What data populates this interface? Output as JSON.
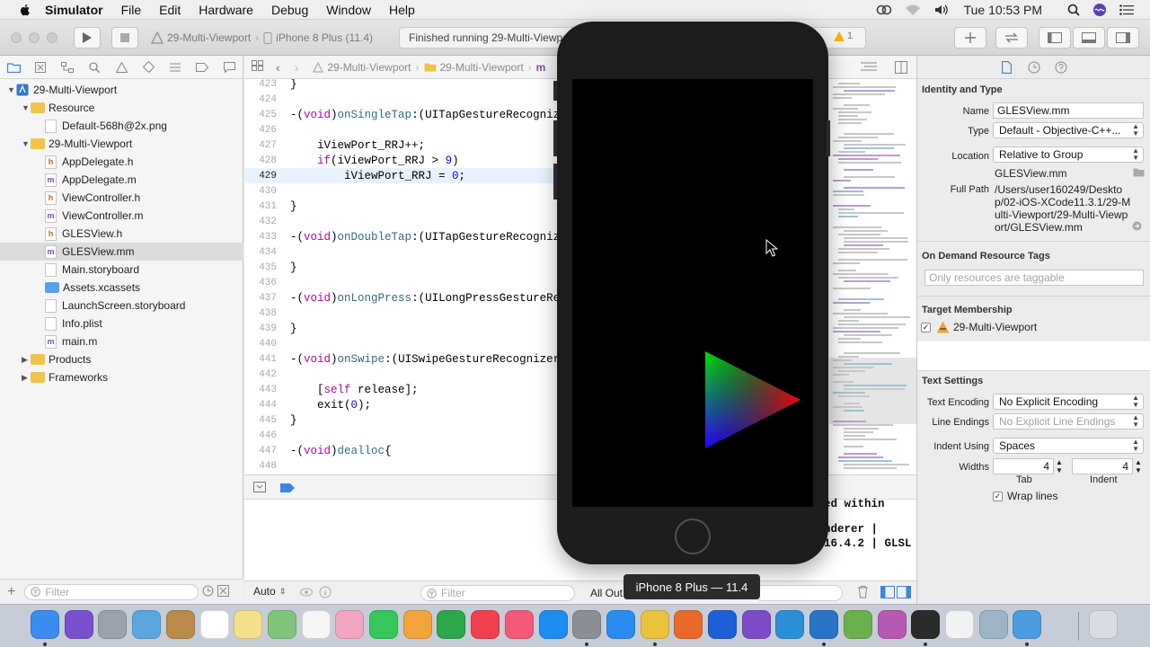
{
  "menubar": {
    "items": [
      "Simulator",
      "File",
      "Edit",
      "Hardware",
      "Debug",
      "Window",
      "Help"
    ],
    "clock": "Tue 10:53 PM"
  },
  "toolbar": {
    "scheme_project": "29-Multi-Viewport",
    "scheme_device": "iPhone 8 Plus (11.4)",
    "activity_status": "Finished running 29-Multi-Viewport",
    "warning_count": "1"
  },
  "navigator": {
    "rows": [
      {
        "label": "29-Multi-Viewport",
        "kind": "project",
        "indent": 0,
        "expanded": true
      },
      {
        "label": "Resource",
        "kind": "folder",
        "indent": 1,
        "expanded": true
      },
      {
        "label": "Default-568h@2x.png",
        "kind": "image",
        "indent": 2
      },
      {
        "label": "29-Multi-Viewport",
        "kind": "folder",
        "indent": 1,
        "expanded": true
      },
      {
        "label": "AppDelegate.h",
        "kind": "h",
        "indent": 2
      },
      {
        "label": "AppDelegate.m",
        "kind": "m",
        "indent": 2
      },
      {
        "label": "ViewController.h",
        "kind": "h",
        "indent": 2
      },
      {
        "label": "ViewController.m",
        "kind": "m",
        "indent": 2
      },
      {
        "label": "GLESView.h",
        "kind": "h",
        "indent": 2
      },
      {
        "label": "GLESView.mm",
        "kind": "m",
        "indent": 2,
        "selected": true
      },
      {
        "label": "Main.storyboard",
        "kind": "storyboard",
        "indent": 2
      },
      {
        "label": "Assets.xcassets",
        "kind": "assets",
        "indent": 2
      },
      {
        "label": "LaunchScreen.storyboard",
        "kind": "storyboard",
        "indent": 2
      },
      {
        "label": "Info.plist",
        "kind": "plist",
        "indent": 2
      },
      {
        "label": "main.m",
        "kind": "m",
        "indent": 2
      },
      {
        "label": "Products",
        "kind": "folder",
        "indent": 1,
        "expanded": false
      },
      {
        "label": "Frameworks",
        "kind": "folder",
        "indent": 1,
        "expanded": false
      }
    ],
    "filter_placeholder": "Filter"
  },
  "jumpbar": {
    "crumb1": "29-Multi-Viewport",
    "crumb2": "29-Multi-Viewport",
    "crumb3": "m"
  },
  "editor": {
    "current_line": 429,
    "lines": [
      {
        "n": "423",
        "segs": [
          {
            "t": "}",
            "c": ""
          }
        ]
      },
      {
        "n": "424",
        "segs": []
      },
      {
        "n": "425",
        "segs": [
          {
            "t": "-(",
            "c": ""
          },
          {
            "t": "void",
            "c": "kw"
          },
          {
            "t": ")",
            "c": ""
          },
          {
            "t": "onSingleTap",
            "c": "fn"
          },
          {
            "t": ":(UITapGestureRecognizer",
            "c": ""
          }
        ]
      },
      {
        "n": "426",
        "segs": []
      },
      {
        "n": "427",
        "segs": [
          {
            "t": "    iViewPort_RRJ++;",
            "c": ""
          }
        ]
      },
      {
        "n": "428",
        "segs": [
          {
            "t": "    ",
            "c": ""
          },
          {
            "t": "if",
            "c": "kw"
          },
          {
            "t": "(iViewPort_RRJ > ",
            "c": ""
          },
          {
            "t": "9",
            "c": "nm"
          },
          {
            "t": ")",
            "c": ""
          }
        ]
      },
      {
        "n": "429",
        "segs": [
          {
            "t": "        iViewPort_RRJ = ",
            "c": ""
          },
          {
            "t": "0",
            "c": "nm"
          },
          {
            "t": ";",
            "c": ""
          }
        ]
      },
      {
        "n": "430",
        "segs": []
      },
      {
        "n": "431",
        "segs": [
          {
            "t": "}",
            "c": ""
          }
        ]
      },
      {
        "n": "432",
        "segs": []
      },
      {
        "n": "433",
        "segs": [
          {
            "t": "-(",
            "c": ""
          },
          {
            "t": "void",
            "c": "kw"
          },
          {
            "t": ")",
            "c": ""
          },
          {
            "t": "onDoubleTap",
            "c": "fn"
          },
          {
            "t": ":(UITapGestureRecognizer",
            "c": ""
          }
        ]
      },
      {
        "n": "434",
        "segs": []
      },
      {
        "n": "435",
        "segs": [
          {
            "t": "}",
            "c": ""
          }
        ]
      },
      {
        "n": "436",
        "segs": []
      },
      {
        "n": "437",
        "segs": [
          {
            "t": "-(",
            "c": ""
          },
          {
            "t": "void",
            "c": "kw"
          },
          {
            "t": ")",
            "c": ""
          },
          {
            "t": "onLongPress",
            "c": "fn"
          },
          {
            "t": ":(UILongPressGestureRecognizer",
            "c": ""
          }
        ]
      },
      {
        "n": "438",
        "segs": []
      },
      {
        "n": "439",
        "segs": [
          {
            "t": "}",
            "c": ""
          }
        ]
      },
      {
        "n": "440",
        "segs": []
      },
      {
        "n": "441",
        "segs": [
          {
            "t": "-(",
            "c": ""
          },
          {
            "t": "void",
            "c": "kw"
          },
          {
            "t": ")",
            "c": ""
          },
          {
            "t": "onSwipe",
            "c": "fn"
          },
          {
            "t": ":(UISwipeGestureRecognizer",
            "c": ""
          }
        ]
      },
      {
        "n": "442",
        "segs": []
      },
      {
        "n": "443",
        "segs": [
          {
            "t": "    [",
            "c": ""
          },
          {
            "t": "self",
            "c": "kw"
          },
          {
            "t": " release];",
            "c": ""
          }
        ]
      },
      {
        "n": "444",
        "segs": [
          {
            "t": "    exit(",
            "c": ""
          },
          {
            "t": "0",
            "c": "nm"
          },
          {
            "t": ");",
            "c": ""
          }
        ]
      },
      {
        "n": "445",
        "segs": [
          {
            "t": "}",
            "c": ""
          }
        ]
      },
      {
        "n": "446",
        "segs": []
      },
      {
        "n": "447",
        "segs": [
          {
            "t": "-(",
            "c": ""
          },
          {
            "t": "void",
            "c": "kw"
          },
          {
            "t": ")",
            "c": ""
          },
          {
            "t": "dealloc",
            "c": "fn"
          },
          {
            "t": "{",
            "c": ""
          }
        ]
      },
      {
        "n": "448",
        "segs": []
      }
    ]
  },
  "console": {
    "lines": [
      "ed within",
      "",
      "nderer |",
      "16.4.2 | GLSL"
    ]
  },
  "debug_bottom": {
    "auto_label": "Auto",
    "filter_placeholder": "Filter",
    "output_label": "All Output"
  },
  "inspector": {
    "identity_title": "Identity and Type",
    "name_label": "Name",
    "name_value": "GLESView.mm",
    "type_label": "Type",
    "type_value": "Default - Objective-C++...",
    "location_label": "Location",
    "location_value": "Relative to Group",
    "location_file": "GLESView.mm",
    "fullpath_label": "Full Path",
    "fullpath_value": "/Users/user160249/Desktop/02-iOS-XCode11.3.1/29-Multi-Viewport/29-Multi-Viewport/GLESView.mm",
    "odr_title": "On Demand Resource Tags",
    "odr_placeholder": "Only resources are taggable",
    "target_title": "Target Membership",
    "target_name": "29-Multi-Viewport",
    "text_title": "Text Settings",
    "encoding_label": "Text Encoding",
    "encoding_value": "No Explicit Encoding",
    "endings_label": "Line Endings",
    "endings_value": "No Explicit Line Endings",
    "indent_using_label": "Indent Using",
    "indent_using_value": "Spaces",
    "widths_label": "Widths",
    "tab_value": "4",
    "indent_value": "4",
    "tab_caption": "Tab",
    "indent_caption": "Indent",
    "wrap_label": "Wrap lines"
  },
  "simulator": {
    "tooltip": "iPhone 8 Plus — 11.4"
  },
  "dock": {
    "icons": [
      {
        "name": "finder-icon",
        "color": "#3b8cf0",
        "running": true
      },
      {
        "name": "siri-icon",
        "color": "#7a4fd0"
      },
      {
        "name": "launchpad-icon",
        "color": "#9aa3ad"
      },
      {
        "name": "preview-icon",
        "color": "#5aa7e0"
      },
      {
        "name": "contacts-icon",
        "color": "#b98a4a"
      },
      {
        "name": "calendar-icon",
        "color": "#ffffff"
      },
      {
        "name": "notes-icon",
        "color": "#f5e08a"
      },
      {
        "name": "maps-icon",
        "color": "#7fc47a"
      },
      {
        "name": "reminders-icon",
        "color": "#f5f5f5"
      },
      {
        "name": "photos-icon",
        "color": "#f2a6c2"
      },
      {
        "name": "messages-icon",
        "color": "#34c759"
      },
      {
        "name": "keynote-icon",
        "color": "#f0a43a"
      },
      {
        "name": "numbers-icon",
        "color": "#2aa84a"
      },
      {
        "name": "news-icon",
        "color": "#f04050"
      },
      {
        "name": "music-icon",
        "color": "#f45a78"
      },
      {
        "name": "app-store-icon",
        "color": "#1e8bf0"
      },
      {
        "name": "system-preferences-icon",
        "color": "#8a8f96",
        "running": true
      },
      {
        "name": "safari-icon",
        "color": "#2a8cf0"
      },
      {
        "name": "chrome-icon",
        "color": "#e9c33b",
        "running": true
      },
      {
        "name": "firefox-icon",
        "color": "#e8692a"
      },
      {
        "name": "dropbox-icon",
        "color": "#1d5fd6"
      },
      {
        "name": "visual-studio-icon",
        "color": "#7e4bc8"
      },
      {
        "name": "vscode-icon",
        "color": "#2a8fd6"
      },
      {
        "name": "xcode-icon",
        "color": "#2a74c8",
        "running": true
      },
      {
        "name": "android-studio-icon",
        "color": "#6ab04c"
      },
      {
        "name": "blender-icon",
        "color": "#b55ab0"
      },
      {
        "name": "terminal-icon",
        "color": "#2b2b2b",
        "running": true
      },
      {
        "name": "textedit-icon",
        "color": "#f2f2f2"
      },
      {
        "name": "image-capture-icon",
        "color": "#9cb4c8"
      },
      {
        "name": "simulator-icon",
        "color": "#4a9be0",
        "running": true
      },
      {
        "name": "trash-icon",
        "color": "#d9dde2"
      }
    ]
  }
}
